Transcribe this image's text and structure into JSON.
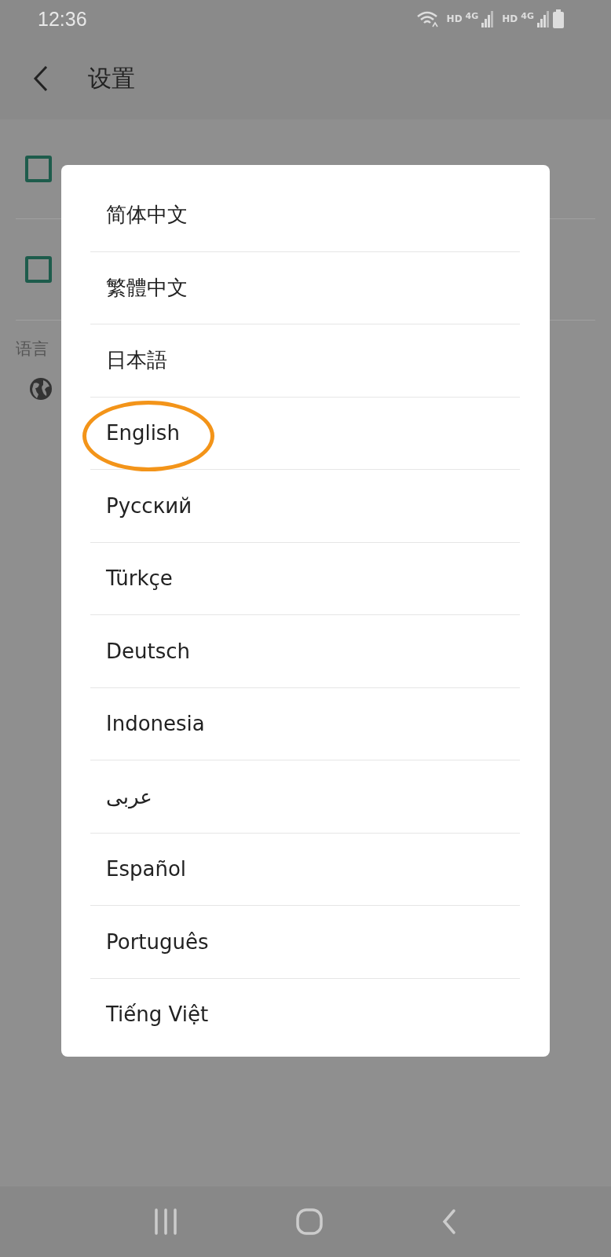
{
  "status_bar": {
    "time": "12:36",
    "network_labels": [
      "HD",
      "4G",
      "HD",
      "4G"
    ]
  },
  "app_bar": {
    "title": "设置"
  },
  "settings": [
    {
      "kind": "checkbox",
      "checked": false
    },
    {
      "kind": "checkbox",
      "checked": false
    }
  ],
  "section": {
    "header": "语言"
  },
  "dialog": {
    "items": [
      {
        "label": "简体中文",
        "circled": false
      },
      {
        "label": "繁體中文",
        "circled": false
      },
      {
        "label": "日本語",
        "circled": false
      },
      {
        "label": "English",
        "circled": true
      },
      {
        "label": "Русский",
        "circled": false
      },
      {
        "label": "Türkçe",
        "circled": false
      },
      {
        "label": "Deutsch",
        "circled": false
      },
      {
        "label": "Indonesia",
        "circled": false
      },
      {
        "label": "عربى",
        "circled": false
      },
      {
        "label": "Español",
        "circled": false
      },
      {
        "label": "Português",
        "circled": false
      },
      {
        "label": "Tiếng Việt",
        "circled": false
      }
    ]
  }
}
